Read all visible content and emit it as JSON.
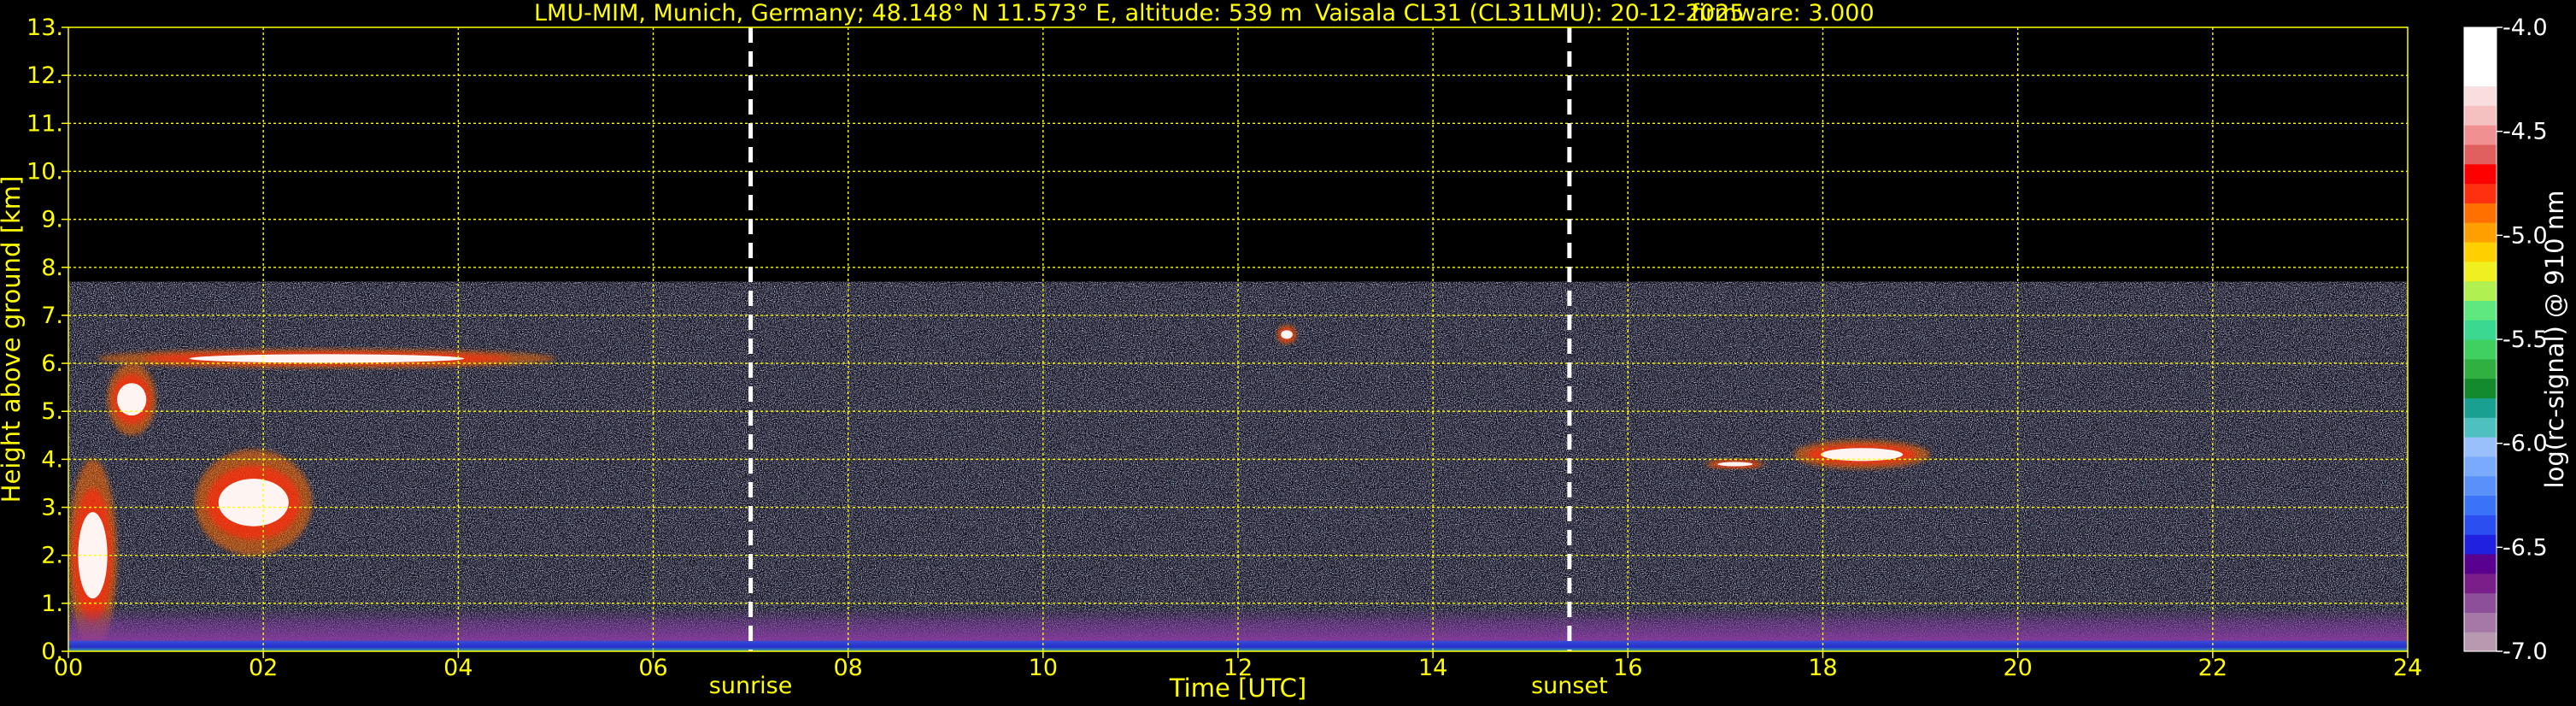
{
  "title": {
    "site": "LMU-MIM, Munich, Germany; 48.148° N 11.573° E, altitude: 539 m",
    "instrument": "Vaisala CL31 (CL31LMU): 20-12-2025",
    "firmware": "firmware: 3.000"
  },
  "chart_data": {
    "type": "heatmap",
    "xlabel": "Time [UTC]",
    "ylabel": "Height above ground [km]",
    "xlim": [
      0,
      24
    ],
    "ylim": [
      0,
      13
    ],
    "x_ticks": [
      "00",
      "02",
      "04",
      "06",
      "08",
      "10",
      "12",
      "14",
      "16",
      "18",
      "20",
      "22",
      "24"
    ],
    "x_tick_values": [
      0,
      2,
      4,
      6,
      8,
      10,
      12,
      14,
      16,
      18,
      20,
      22,
      24
    ],
    "y_ticks": [
      "0.",
      "1.",
      "2.",
      "3.",
      "4.",
      "5.",
      "6.",
      "7.",
      "8.",
      "9.",
      "10.",
      "11.",
      "12.",
      "13."
    ],
    "y_tick_values": [
      0,
      1,
      2,
      3,
      4,
      5,
      6,
      7,
      8,
      9,
      10,
      11,
      12,
      13
    ],
    "grid": true,
    "grid_color": "#ffff00",
    "data_top_km": 7.7,
    "events": [
      {
        "label": "sunrise",
        "time": 7.0
      },
      {
        "label": "sunset",
        "time": 15.4
      }
    ],
    "features": [
      {
        "kind": "cloud",
        "t": [
          0.3,
          5.0
        ],
        "h": [
          5.9,
          6.3
        ]
      },
      {
        "kind": "cloud",
        "t": [
          1.3,
          2.5
        ],
        "h": [
          2.0,
          4.2
        ]
      },
      {
        "kind": "cloud",
        "t": [
          0.4,
          0.9
        ],
        "h": [
          4.5,
          6.0
        ]
      },
      {
        "kind": "cloud",
        "t": [
          0.0,
          0.5
        ],
        "h": [
          0.0,
          4.0
        ]
      },
      {
        "kind": "cloud",
        "t": [
          16.8,
          17.4
        ],
        "h": [
          3.8,
          4.0
        ]
      },
      {
        "kind": "cloud",
        "t": [
          17.7,
          19.1
        ],
        "h": [
          3.8,
          4.4
        ]
      },
      {
        "kind": "cloud",
        "t": [
          12.4,
          12.6
        ],
        "h": [
          6.4,
          6.8
        ]
      },
      {
        "kind": "boundary_layer",
        "t": [
          0,
          24
        ],
        "h": [
          0.0,
          0.9
        ]
      }
    ],
    "colorbar": {
      "label": "log(rc-signal) @ 910 nm",
      "ticks": [
        "-4.0",
        "-4.5",
        "-5.0",
        "-5.5",
        "-6.0",
        "-6.5",
        "-7.0"
      ],
      "tick_values": [
        -4.0,
        -4.5,
        -5.0,
        -5.5,
        -6.0,
        -6.5,
        -7.0
      ],
      "range": [
        -7.0,
        -4.0
      ],
      "colors": [
        "#b89ab0",
        "#a678a8",
        "#8e4f9a",
        "#7a1f8a",
        "#5a0090",
        "#2020e0",
        "#2a4ef0",
        "#3a72f8",
        "#5a90fa",
        "#7aaafc",
        "#9ac0fc",
        "#4ec0c0",
        "#1aa090",
        "#138a2e",
        "#30b040",
        "#40d060",
        "#3ad890",
        "#60e880",
        "#b0f050",
        "#f0f020",
        "#ffd000",
        "#ffa000",
        "#ff7000",
        "#ff3010",
        "#ff0000",
        "#e06060",
        "#f09090",
        "#f4c0c0",
        "#f8dede",
        "#ffffff",
        "#ffffff",
        "#ffffff"
      ]
    }
  }
}
